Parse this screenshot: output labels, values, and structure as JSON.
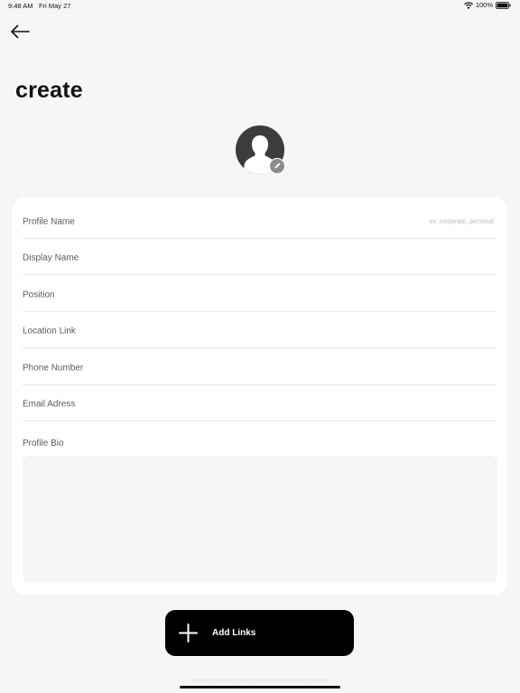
{
  "status_bar": {
    "time": "9:48 AM",
    "date": "Fri May 27",
    "battery_percent": "100%",
    "icons": [
      "wifi-icon",
      "battery-icon"
    ]
  },
  "header": {
    "back_icon": "arrow-left-icon",
    "title": "create"
  },
  "avatar": {
    "icon": "person-silhouette-icon",
    "edit_icon": "pencil-icon"
  },
  "form": {
    "fields": [
      {
        "label": "Profile Name",
        "hint": "ex: corporate, personal",
        "value": ""
      },
      {
        "label": "Display Name",
        "value": ""
      },
      {
        "label": "Position",
        "value": ""
      },
      {
        "label": "Location Link",
        "value": ""
      },
      {
        "label": "Phone Number",
        "value": ""
      },
      {
        "label": "Email Adress",
        "value": ""
      }
    ],
    "bio": {
      "label": "Profile Bio",
      "value": ""
    }
  },
  "actions": {
    "add_links_label": "Add Links",
    "add_links_icon": "plus-icon"
  },
  "colors": {
    "background": "#f6f6f6",
    "card": "#ffffff",
    "button": "#000000",
    "avatar": "#3a3c3e",
    "edit_badge": "#8d8d8d"
  }
}
